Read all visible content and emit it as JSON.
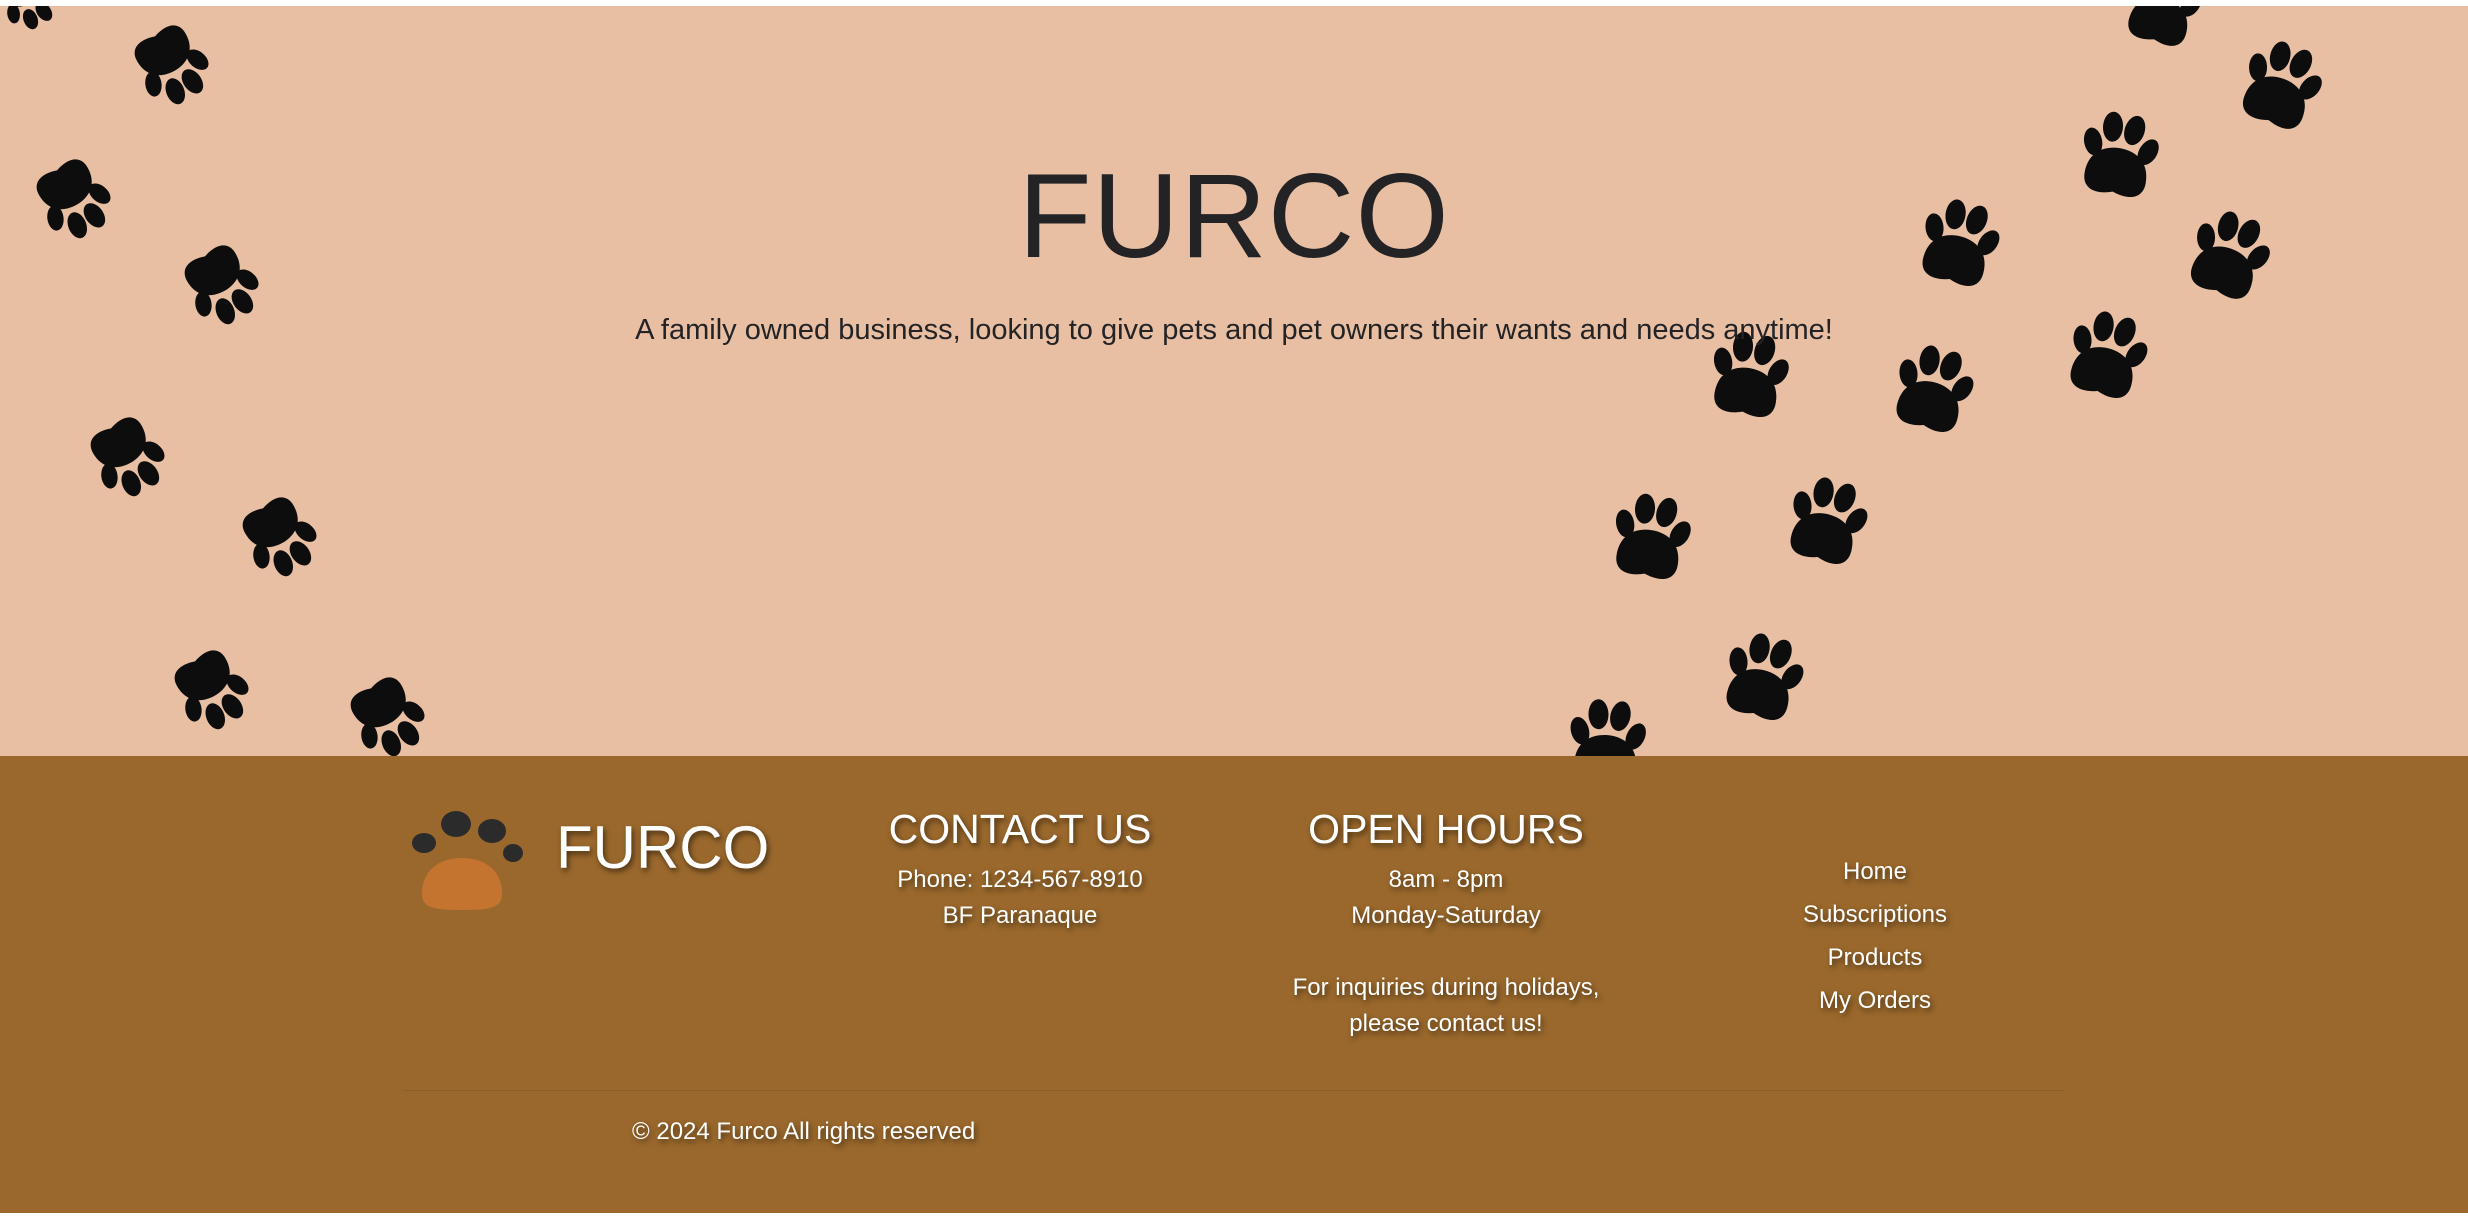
{
  "hero": {
    "title": "FURCO",
    "subtitle": "A family owned business, looking to give pets and pet owners their wants and needs anytime!"
  },
  "colors": {
    "hero_bg": "#e8bfa3",
    "footer_bg": "#9a682c",
    "paw": "#0d0d0d",
    "logo_toes": "#2b2b2b",
    "logo_pad": "#c4742e"
  },
  "footer": {
    "brand": {
      "name": "FURCO",
      "logo_icon": "paw-icon"
    },
    "contact": {
      "heading": "CONTACT US",
      "phone": "Phone: 1234-567-8910",
      "address": "BF Paranaque"
    },
    "hours": {
      "heading": "OPEN HOURS",
      "time": "8am - 8pm",
      "days": "Monday-Saturday",
      "holiday_line1": "For inquiries during holidays,",
      "holiday_line2": "please contact us!"
    },
    "nav": [
      "Home",
      "Subscriptions",
      "Products",
      "My Orders"
    ],
    "copyright": "© 2024 Furco All rights reserved"
  }
}
